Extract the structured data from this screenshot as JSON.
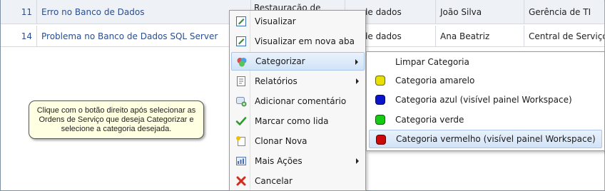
{
  "grid": {
    "rows": [
      {
        "num": "11",
        "subject": "Erro no Banco de Dados",
        "project": "Restauração de",
        "category": "co de dados",
        "user": "João Silva",
        "dept": "Gerência de TI"
      },
      {
        "num": "14",
        "subject": "Problema no Banco de Dados SQL Server",
        "project": "",
        "category": "co de dados",
        "user": "Ana Beatriz",
        "dept": "Central de Serviço"
      }
    ]
  },
  "note": "Clique com o botão direito após selecionar as Ordens de Serviço que deseja Categorizar e selecione a categoria desejada.",
  "menu": {
    "items": [
      {
        "label": "Visualizar",
        "icon": "view-icon"
      },
      {
        "label": "Visualizar em nova aba",
        "icon": "view-new-tab-icon"
      },
      {
        "label": "Categorizar",
        "icon": "categorize-icon",
        "submenu": true,
        "active": true
      },
      {
        "label": "Relatórios",
        "icon": "reports-icon",
        "submenu": true
      },
      {
        "label": "Adicionar comentário",
        "icon": "comment-add-icon"
      },
      {
        "label": "Marcar como lida",
        "icon": "checkmark-icon"
      },
      {
        "label": "Clonar Nova",
        "icon": "clone-icon"
      },
      {
        "label": "Mais Ações",
        "icon": "more-actions-icon",
        "submenu": true
      },
      {
        "label": "Cancelar",
        "icon": "cancel-icon"
      }
    ]
  },
  "submenu": {
    "items": [
      {
        "label": "Limpar Categoria",
        "color": ""
      },
      {
        "label": "Categoria amarelo",
        "color": "#e8e000"
      },
      {
        "label": "Categoria azul  (visível painel Workspace)",
        "color": "#0a14c8"
      },
      {
        "label": "Categoria verde",
        "color": "#14cc14"
      },
      {
        "label": "Categoria vermelho  (visível painel Workspace)",
        "color": "#cc0a0a",
        "active": true
      }
    ]
  },
  "colors": {
    "link": "#2a4e8f",
    "highlight": "#d2e3f7"
  }
}
